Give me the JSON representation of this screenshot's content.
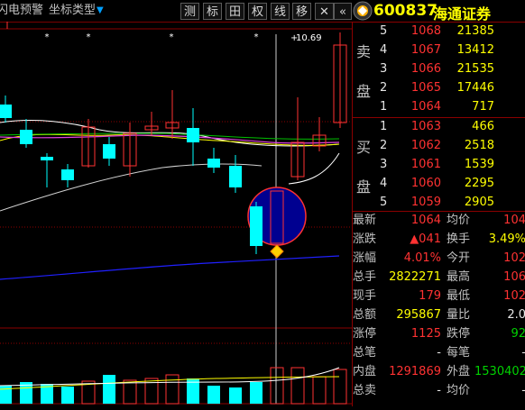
{
  "toolbar": {
    "alert_label": "闪电预警",
    "coord_type_label": "坐标类型",
    "dropdown_arrow": "▼",
    "buttons": [
      "测",
      "标",
      "田",
      "权",
      "线",
      "移"
    ],
    "close_label": "✕"
  },
  "stock": {
    "code": "600837",
    "name": "海通证券"
  },
  "chart": {
    "price_label": "10.69",
    "hollow_candle_color": "#ff3232",
    "solid_candle_color": "#00ffff"
  },
  "orderbook": {
    "sell_label": [
      "卖",
      "盘"
    ],
    "buy_label": [
      "买",
      "盘"
    ],
    "asks": [
      {
        "level": "5",
        "price": "1068",
        "volume": "21385"
      },
      {
        "level": "4",
        "price": "1067",
        "volume": "13412"
      },
      {
        "level": "3",
        "price": "1066",
        "volume": "21535"
      },
      {
        "level": "2",
        "price": "1065",
        "volume": "17446"
      },
      {
        "level": "1",
        "price": "1064",
        "volume": "717"
      }
    ],
    "bids": [
      {
        "level": "1",
        "price": "1063",
        "volume": "466"
      },
      {
        "level": "2",
        "price": "1062",
        "volume": "2518"
      },
      {
        "level": "3",
        "price": "1061",
        "volume": "1539"
      },
      {
        "level": "4",
        "price": "1060",
        "volume": "2295"
      },
      {
        "level": "5",
        "price": "1059",
        "volume": "2905"
      }
    ]
  },
  "stats": [
    {
      "l1": "最新",
      "v1": "1064",
      "l2": "均价",
      "v2": "104"
    },
    {
      "l1": "涨跌",
      "v1": "▲041",
      "l2": "换手",
      "v2": "3.49%"
    },
    {
      "l1": "涨幅",
      "v1": "4.01%",
      "l2": "今开",
      "v2": "102"
    },
    {
      "l1": "总手",
      "v1": "2822271",
      "l2": "最高",
      "v2": "106"
    },
    {
      "l1": "现手",
      "v1": "179",
      "l2": "最低",
      "v2": "102"
    },
    {
      "l1": "总额",
      "v1": "295867",
      "l2": "量比",
      "v2": "2.0"
    },
    {
      "l1": "涨停",
      "v1": "1125",
      "l2": "跌停",
      "v2": "92"
    },
    {
      "l1": "总笔",
      "v1": "-",
      "l2": "每笔",
      "v2": "-"
    },
    {
      "l1": "内盘",
      "v1": "1291869",
      "l2": "外盘",
      "v2": "1530402"
    },
    {
      "l1": "总卖",
      "v1": "-",
      "l2": "均价",
      "v2": "-"
    }
  ]
}
